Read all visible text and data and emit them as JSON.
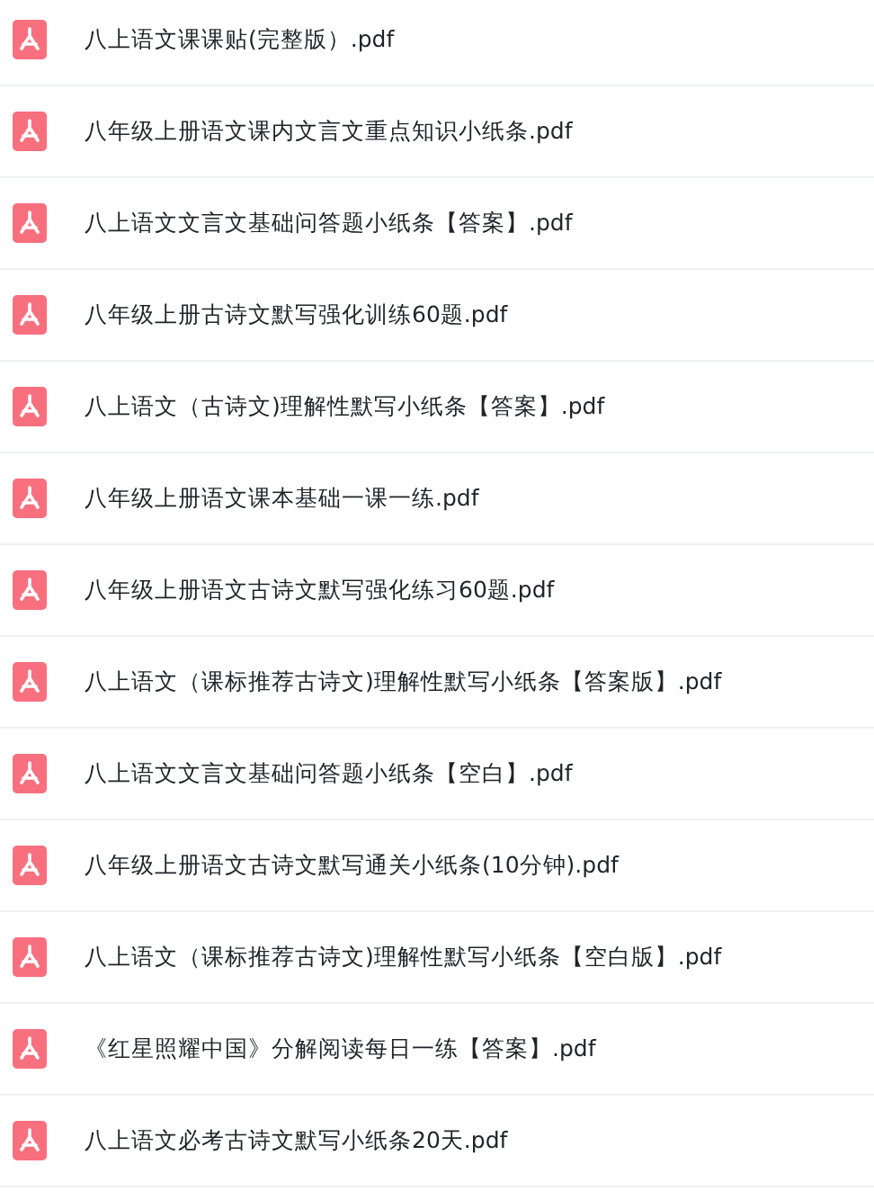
{
  "files": [
    {
      "name": "八上语文课课贴(完整版）.pdf"
    },
    {
      "name": "八年级上册语文课内文言文重点知识小纸条.pdf"
    },
    {
      "name": "八上语文文言文基础问答题小纸条【答案】.pdf"
    },
    {
      "name": "八年级上册古诗文默写强化训练60题.pdf"
    },
    {
      "name": "八上语文（古诗文)理解性默写小纸条【答案】.pdf"
    },
    {
      "name": "八年级上册语文课本基础一课一练.pdf"
    },
    {
      "name": "八年级上册语文古诗文默写强化练习60题.pdf"
    },
    {
      "name": "八上语文（课标推荐古诗文)理解性默写小纸条【答案版】.pdf"
    },
    {
      "name": "八上语文文言文基础问答题小纸条【空白】.pdf"
    },
    {
      "name": "八年级上册语文古诗文默写通关小纸条(10分钟).pdf"
    },
    {
      "name": "八上语文（课标推荐古诗文)理解性默写小纸条【空白版】.pdf"
    },
    {
      "name": "《红星照耀中国》分解阅读每日一练【答案】.pdf"
    },
    {
      "name": "八上语文必考古诗文默写小纸条20天.pdf"
    }
  ]
}
